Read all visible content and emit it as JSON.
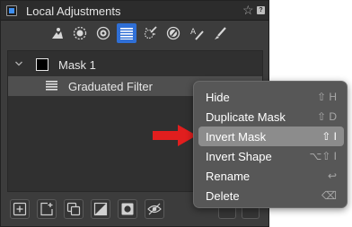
{
  "panel": {
    "title": "Local Adjustments",
    "header_icons": [
      "panel-toggle-icon",
      "star-icon",
      "help-icon"
    ],
    "help_label": "?",
    "toolbar_tools": [
      "layers-icon",
      "brush-mask-icon",
      "radial-mask-icon",
      "graduated-mask-icon",
      "magic-brush-icon",
      "color-picker-icon",
      "text-annotation-icon",
      "eraser-brush-icon"
    ],
    "active_tool_index": 3
  },
  "layers": {
    "mask_name": "Mask 1",
    "filter_name": "Graduated Filter"
  },
  "bottom_toolbar": [
    "add-layer-icon",
    "add-adjustment-layer-icon",
    "duplicate-layer-icon",
    "invert-icon",
    "mask-circle-icon",
    "visibility-icon"
  ],
  "context_menu": {
    "items": [
      {
        "label": "Hide",
        "shortcut": "⇧ H"
      },
      {
        "label": "Duplicate Mask",
        "shortcut": "⇧ D"
      },
      {
        "label": "Invert Mask",
        "shortcut": "⇧ I",
        "highlighted": true
      },
      {
        "label": "Invert Shape",
        "shortcut": "⌥⇧ I"
      },
      {
        "label": "Rename",
        "shortcut": "↩"
      },
      {
        "label": "Delete",
        "shortcut": "⌫"
      }
    ]
  },
  "colors": {
    "panel_bg": "#3c3c3c",
    "active_tool": "#2f6fd6",
    "menu_bg": "#575757",
    "menu_highlight": "#8c8c8c",
    "arrow": "#e11e1e"
  }
}
